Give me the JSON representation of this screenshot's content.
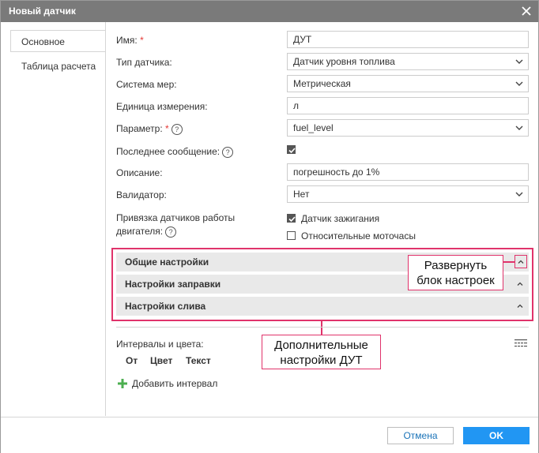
{
  "dialog": {
    "title": "Новый датчик",
    "close_icon": "close-icon"
  },
  "tabs": [
    {
      "label": "Основное",
      "active": true
    },
    {
      "label": "Таблица расчета",
      "active": false
    }
  ],
  "form": {
    "name": {
      "label": "Имя:",
      "required": "*",
      "value": "ДУТ"
    },
    "sensor_type": {
      "label": "Тип датчика:",
      "value": "Датчик уровня топлива"
    },
    "measurement_system": {
      "label": "Система мер:",
      "value": "Метрическая"
    },
    "unit": {
      "label": "Единица измерения:",
      "value": "л"
    },
    "parameter": {
      "label": "Параметр:",
      "required": "*",
      "help": "?",
      "value": "fuel_level"
    },
    "last_message": {
      "label": "Последнее сообщение:",
      "help": "?",
      "checked": true
    },
    "description": {
      "label": "Описание:",
      "value": "погрешность до 1%"
    },
    "validator": {
      "label": "Валидатор:",
      "value": "Нет"
    },
    "engine_binding": {
      "label_line1": "Привязка датчиков работы",
      "label_line2": "двигателя:",
      "help": "?",
      "options": [
        {
          "label": "Датчик зажигания",
          "checked": true
        },
        {
          "label": "Относительные моточасы",
          "checked": false
        }
      ]
    }
  },
  "sections": [
    {
      "title": "Общие настройки"
    },
    {
      "title": "Настройки заправки"
    },
    {
      "title": "Настройки слива"
    }
  ],
  "callouts": {
    "expand": {
      "line1": "Развернуть",
      "line2": "блок настроек"
    },
    "extra": {
      "line1": "Дополнительные",
      "line2": "настройки ДУТ"
    }
  },
  "intervals": {
    "label": "Интервалы и цвета:",
    "columns": [
      "От",
      "Цвет",
      "Текст"
    ],
    "add_label": "Добавить интервал"
  },
  "footer": {
    "cancel_label": "Отмена",
    "ok_label": "OK"
  },
  "colors": {
    "titlebar": "#7a7a7a",
    "accent": "#2196f3",
    "highlight": "#e0336b",
    "add_green": "#4caf50"
  }
}
